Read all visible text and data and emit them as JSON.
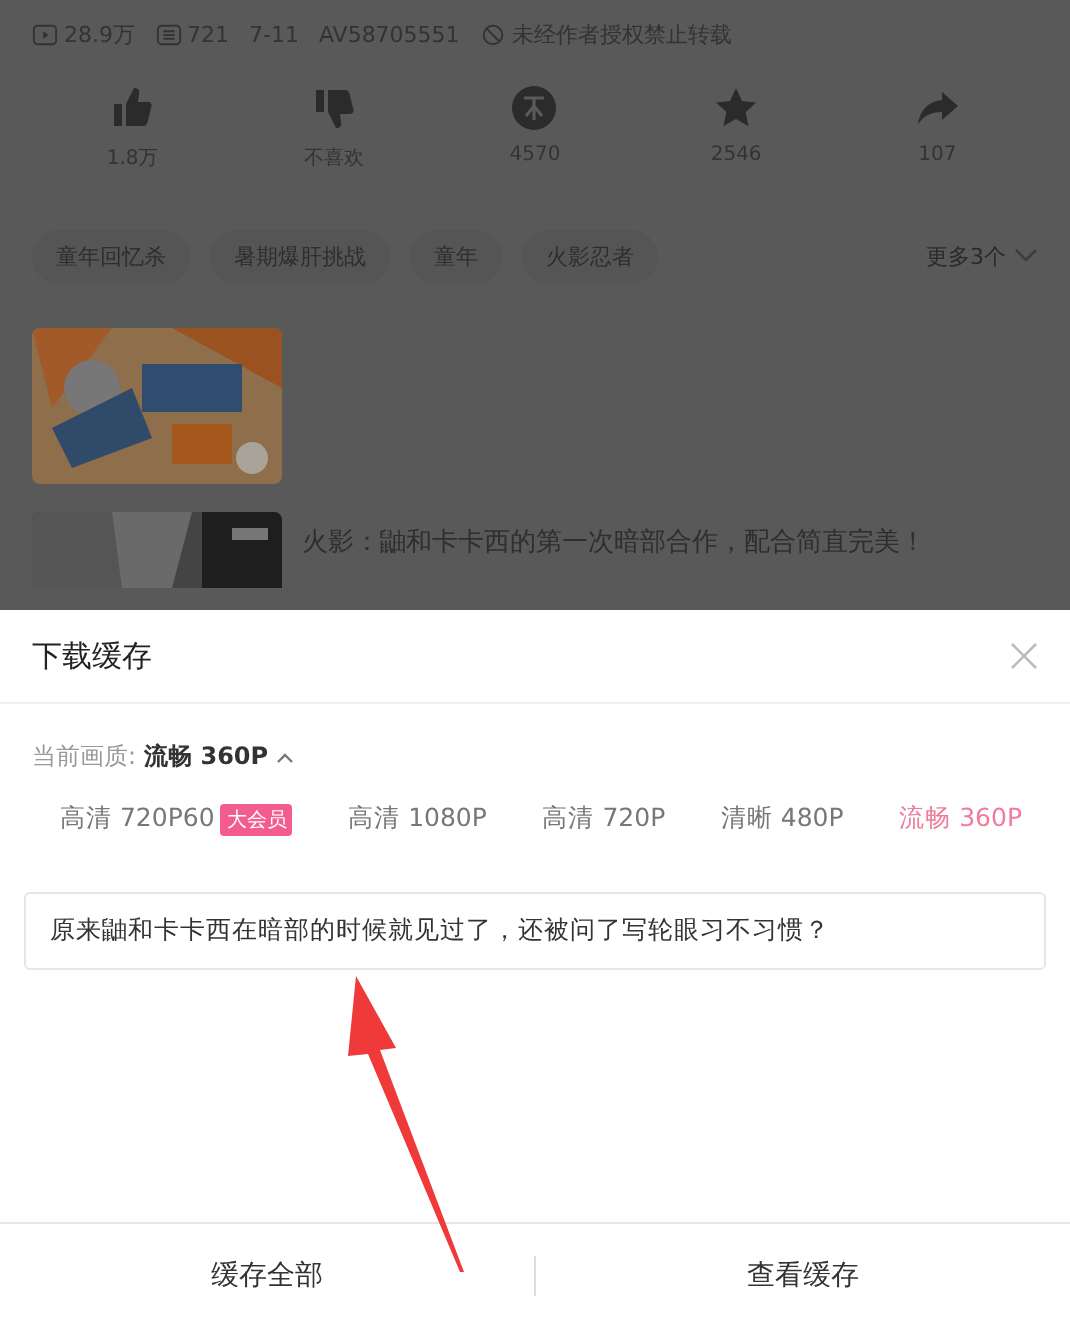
{
  "stats": {
    "views": "28.9万",
    "danmaku": "721",
    "date": "7-11",
    "av": "AV58705551",
    "notice": "未经作者授权禁止转载"
  },
  "actions": [
    {
      "kind": "like",
      "label": "1.8万"
    },
    {
      "kind": "dislike",
      "label": "不喜欢"
    },
    {
      "kind": "coin",
      "label": "4570"
    },
    {
      "kind": "favorite",
      "label": "2546"
    },
    {
      "kind": "share",
      "label": "107"
    }
  ],
  "tags": [
    "童年回忆杀",
    "暑期爆肝挑战",
    "童年",
    "火影忍者"
  ],
  "more_tags": "更多3个",
  "related": [
    {
      "kind": "picture"
    },
    {
      "kind": "picture",
      "title": "火影：鼬和卡卡西的第一次暗部合作，配合简直完美！"
    }
  ],
  "sheet": {
    "title": "下载缓存",
    "current_label": "当前画质:",
    "current_value": "流畅 360P",
    "qualities": [
      {
        "label": "高清 720P60",
        "badge": "大会员",
        "selected": false
      },
      {
        "label": "高清 1080P",
        "selected": false
      },
      {
        "label": "高清 720P",
        "selected": false
      },
      {
        "label": "清晰 480P",
        "selected": false
      },
      {
        "label": "流畅 360P",
        "selected": true
      }
    ],
    "episode": "原来鼬和卡卡西在暗部的时候就见过了，还被问了写轮眼习不习惯？",
    "buttons": [
      "缓存全部",
      "查看缓存"
    ]
  }
}
